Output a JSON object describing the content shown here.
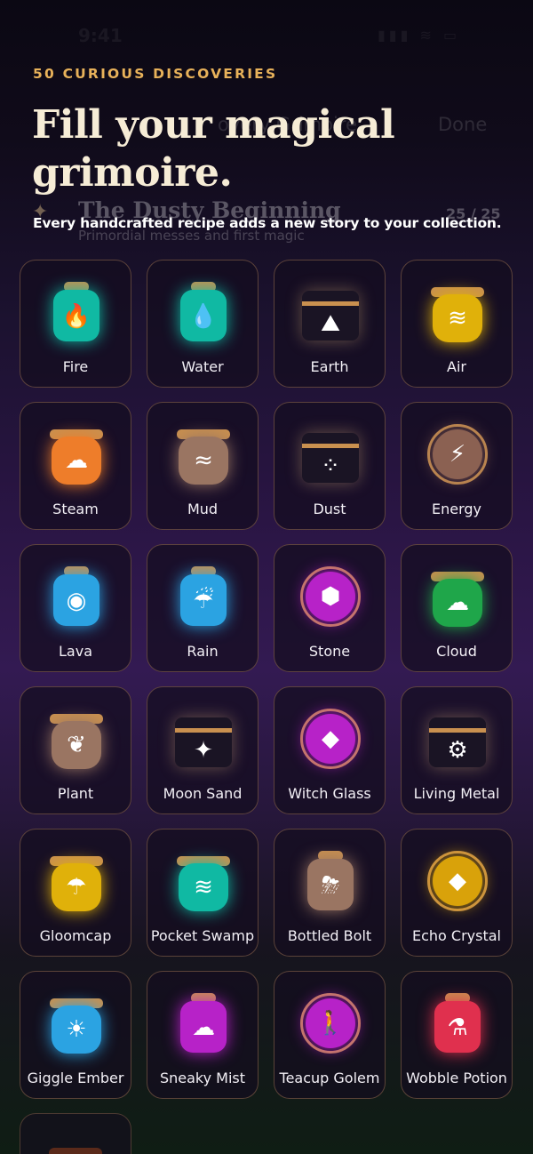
{
  "ghost": {
    "time": "9:41",
    "status": "▮▮▮ ≋ ▭",
    "nav_title": "overy Grimoire",
    "done": "Done",
    "sparkle": "✦",
    "section_title": "The Dusty Beginning",
    "section_count": "25 / 25",
    "section_subtitle": "Primordial messes and first magic"
  },
  "header": {
    "eyebrow": "50 CURIOUS DISCOVERIES",
    "headline": "Fill your magical grimoire.",
    "tagline": "Every handcrafted recipe adds a new story to your collection."
  },
  "items": [
    {
      "label": "Fire",
      "shape": "bottle",
      "color": "#10b9a3",
      "glyph": "🔥",
      "icon": "flame-icon"
    },
    {
      "label": "Water",
      "shape": "bottle",
      "color": "#10b9a3",
      "glyph": "💧",
      "icon": "drop-icon"
    },
    {
      "label": "Earth",
      "shape": "chest",
      "color": "#1a1424",
      "glyph": "⛰",
      "icon": "mountain-icon"
    },
    {
      "label": "Air",
      "shape": "jar",
      "color": "#e0b10a",
      "glyph": "≋",
      "icon": "wind-icon"
    },
    {
      "label": "Steam",
      "shape": "jar",
      "color": "#ee7d2a",
      "glyph": "☁",
      "icon": "cloud-icon"
    },
    {
      "label": "Mud",
      "shape": "jar",
      "color": "#9a7562",
      "glyph": "≈",
      "icon": "waves-icon"
    },
    {
      "label": "Dust",
      "shape": "chest",
      "color": "#1a1424",
      "glyph": "⁘",
      "icon": "dots-icon"
    },
    {
      "label": "Energy",
      "shape": "orb",
      "color": "#8b6152",
      "glyph": "⚡",
      "icon": "bolt-icon"
    },
    {
      "label": "Lava",
      "shape": "bottle",
      "color": "#2ba3e2",
      "glyph": "◉",
      "icon": "flame-drop-icon"
    },
    {
      "label": "Rain",
      "shape": "bottle",
      "color": "#2ba3e2",
      "glyph": "☔",
      "icon": "rain-cloud-icon"
    },
    {
      "label": "Stone",
      "shape": "orb",
      "color": "#b722c8",
      "glyph": "⬢",
      "icon": "hexagon-icon"
    },
    {
      "label": "Cloud",
      "shape": "jar",
      "color": "#1fa64a",
      "glyph": "☁",
      "icon": "cloud-icon"
    },
    {
      "label": "Plant",
      "shape": "jar",
      "color": "#9a7562",
      "glyph": "❦",
      "icon": "leaf-icon"
    },
    {
      "label": "Moon Sand",
      "shape": "chest",
      "color": "#1a1424",
      "glyph": "✦",
      "icon": "sparkles-icon"
    },
    {
      "label": "Witch Glass",
      "shape": "orb",
      "color": "#b722c8",
      "glyph": "◆",
      "icon": "diamond-icon"
    },
    {
      "label": "Living Metal",
      "shape": "chest",
      "color": "#1a1424",
      "glyph": "⚙",
      "icon": "gear-icon"
    },
    {
      "label": "Gloomcap",
      "shape": "jar",
      "color": "#e0b10a",
      "glyph": "☂",
      "icon": "umbrella-icon"
    },
    {
      "label": "Pocket Swamp",
      "shape": "jar",
      "color": "#10b9a3",
      "glyph": "≋",
      "icon": "water-wind-icon"
    },
    {
      "label": "Bottled Bolt",
      "shape": "bottle",
      "color": "#9a7562",
      "glyph": "⛈",
      "icon": "storm-cloud-icon"
    },
    {
      "label": "Echo Crystal",
      "shape": "orb",
      "color": "#d9a20a",
      "glyph": "◆",
      "icon": "diamond-icon"
    },
    {
      "label": "Giggle Ember",
      "shape": "jar",
      "color": "#2ba3e2",
      "glyph": "☀",
      "icon": "sun-icon"
    },
    {
      "label": "Sneaky Mist",
      "shape": "bottle",
      "color": "#b722c8",
      "glyph": "☁",
      "icon": "fog-icon"
    },
    {
      "label": "Teacup Golem",
      "shape": "orb",
      "color": "#b722c8",
      "glyph": "🚶",
      "icon": "figure-icon"
    },
    {
      "label": "Wobble Potion",
      "shape": "bottle",
      "color": "#e0304e",
      "glyph": "⚗",
      "icon": "test-tubes-icon"
    }
  ]
}
